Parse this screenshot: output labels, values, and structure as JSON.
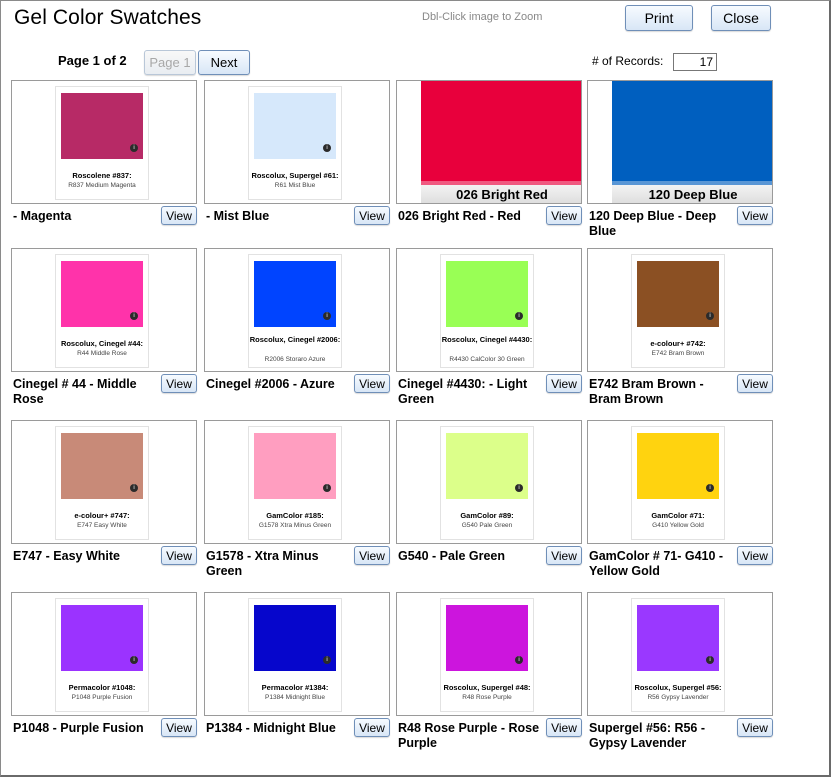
{
  "window": {
    "title": "Gel Color Swatches",
    "hint": "Dbl-Click image to Zoom",
    "print_label": "Print",
    "close_label": "Close"
  },
  "pager": {
    "label": "Page 1 of 2",
    "page_button": "Page 1",
    "next_button": "Next",
    "records_label": "# of Records:",
    "records_value": "17"
  },
  "view_label": "View",
  "swatches": [
    {
      "caption": " - Magenta",
      "color": "#b72a66",
      "card_name": "Roscolene #837:",
      "card_desc": "R837 Medium Magenta"
    },
    {
      "caption": " - Mist Blue",
      "color": "#d6e8fb",
      "card_name": "Roscolux, Supergel #61:",
      "card_desc": "R61 Mist Blue"
    },
    {
      "caption": "026 Bright Red - Red",
      "color": "#e8003c",
      "full_label": "026 Bright Red"
    },
    {
      "caption": "120 Deep Blue - Deep Blue",
      "color": "#005fbf",
      "full_label": "120 Deep Blue"
    },
    {
      "caption": "Cinegel # 44 - Middle Rose",
      "color": "#ff33aa",
      "card_name": "Roscolux, Cinegel #44:",
      "card_desc": "R44 Middle Rose"
    },
    {
      "caption": "Cinegel #2006 - Azure",
      "color": "#0044ff",
      "card_name": "Roscolux, Cinegel #2006:",
      "card_desc": "R2006 Storaro Azure"
    },
    {
      "caption": "Cinegel #4430: - Light Green",
      "color": "#99ff55",
      "card_name": "Roscolux, Cinegel #4430:",
      "card_desc": "R4430 CalColor 30 Green"
    },
    {
      "caption": "E742 Bram Brown - Bram Brown",
      "color": "#8b5023",
      "card_name": "e-colour+ #742:",
      "card_desc": "E742 Bram Brown"
    },
    {
      "caption": "E747 - Easy White",
      "color": "#c88a78",
      "card_name": "e-colour+ #747:",
      "card_desc": "E747 Easy White"
    },
    {
      "caption": "G1578 - Xtra Minus Green",
      "color": "#ff9ec0",
      "card_name": "GamColor #185:",
      "card_desc": "G1578 Xtra Minus Green"
    },
    {
      "caption": "G540 - Pale Green",
      "color": "#dcff8a",
      "card_name": "GamColor #89:",
      "card_desc": "G540 Pale Green"
    },
    {
      "caption": "GamColor # 71- G410 - Yellow Gold",
      "color": "#ffd30f",
      "card_name": "GamColor #71:",
      "card_desc": "G410 Yellow Gold"
    },
    {
      "caption": "P1048 - Purple Fusion",
      "color": "#9b33ff",
      "card_name": "Permacolor #1048:",
      "card_desc": "P1048 Purple Fusion"
    },
    {
      "caption": "P1384 - Midnight Blue",
      "color": "#0606cc",
      "card_name": "Permacolor #1384:",
      "card_desc": "P1384 Midnight Blue"
    },
    {
      "caption": "R48 Rose Purple - Rose Purple",
      "color": "#cc15dd",
      "card_name": "Roscolux, Supergel #48:",
      "card_desc": "R48 Rose Purple"
    },
    {
      "caption": "Supergel #56:  R56 - Gypsy Lavender",
      "color": "#9a38ff",
      "card_name": "Roscolux, Supergel #56:",
      "card_desc": "R56 Gypsy Lavender"
    }
  ]
}
